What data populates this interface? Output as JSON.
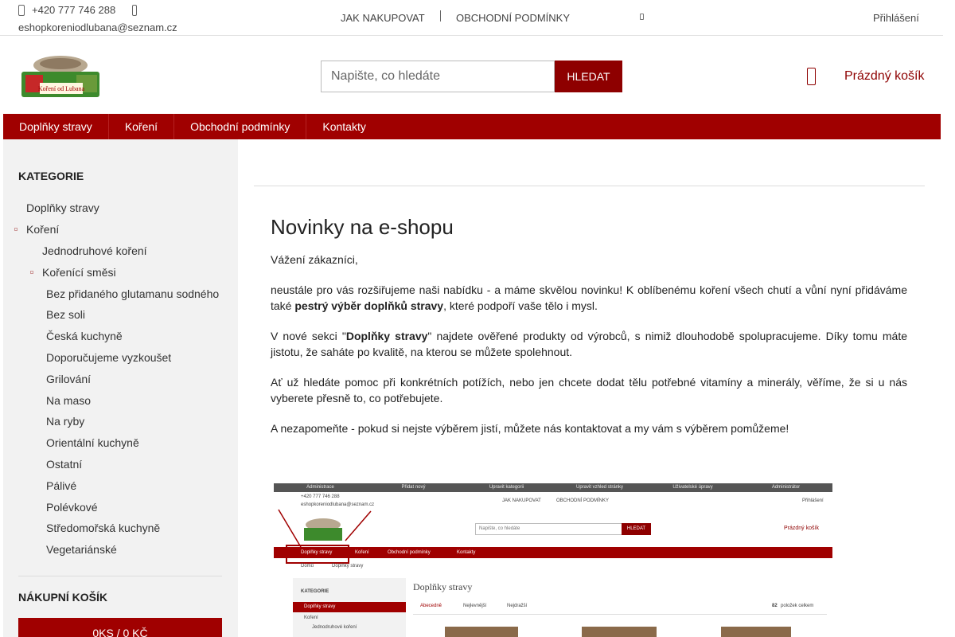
{
  "topbar": {
    "phone": "+420 777 746 288",
    "email": "eshopkoreniodlubana@seznam.cz",
    "links": [
      "JAK NAKUPOVAT",
      "OBCHODNÍ PODMÍNKY"
    ],
    "login": "Přihlášení"
  },
  "header": {
    "logo_text": "Koření od Lubana",
    "search_placeholder": "Napište, co hledáte",
    "search_button": "HLEDAT",
    "cart_label": "Prázdný košík"
  },
  "nav": [
    "Doplňky stravy",
    "Koření",
    "Obchodní podmínky",
    "Kontakty"
  ],
  "sidebar": {
    "categories_title": "KATEGORIE",
    "level1": [
      "Doplňky stravy",
      "Koření"
    ],
    "level2": [
      "Jednodruhové koření",
      "Kořenící směsi"
    ],
    "level3": [
      "Bez přidaného glutamanu sodného",
      "Bez soli",
      "Česká kuchyně",
      "Doporučujeme vyzkoušet",
      "Grilování",
      "Na maso",
      "Na ryby",
      "Orientální kuchyně",
      "Ostatní",
      "Pálivé",
      "Polévkové",
      "Středomořská kuchyně",
      "Vegetariánské"
    ],
    "cart_title": "NÁKUPNÍ KOŠÍK",
    "cart_value": "0KS / 0 KČ"
  },
  "article": {
    "title": "Novinky na e-shopu",
    "greeting": "Vážení zákazníci,",
    "p1_a": "neustále pro vás rozšiřujeme naši nabídku - a máme skvělou novinku! K oblíbenému koření všech chutí a vůní nyní přidáváme také ",
    "p1_bold": "pestrý výběr doplňků stravy",
    "p1_b": ", které podpoří vaše tělo i mysl.",
    "p2_a": "V nové sekci \"",
    "p2_bold": "Doplňky stravy",
    "p2_b": "\" najdete ověřené produkty od výrobců, s nimiž dlouhodobě spolupracujeme. Díky tomu máte jistotu, že saháte po kvalitě, na kterou se můžete spolehnout.",
    "p3": "Ať už hledáte pomoc při konkrétních potížích, nebo jen chcete dodat tělu potřebné vitamíny a minerály, věříme, že si u nás vyberete přesně to, co potřebujete.",
    "p4": "A nezapomeňte - pokud si nejste výběrem jistí, můžete nás kontaktovat a my vám s výběrem pomůžeme!"
  },
  "screenshot": {
    "admin_bar": [
      "Administrace",
      "Přidat nový",
      "Upravit kategorii",
      "Upravit vzhled stránky",
      "Uživatelské úpravy",
      "Administrátor"
    ],
    "phone": "+420 777 746 288",
    "email": "eshopkoreniodlubana@seznam.cz",
    "links": [
      "JAK NAKUPOVAT",
      "OBCHODNÍ PODMÍNKY"
    ],
    "login": "Přihlášení",
    "search_placeholder": "Napište, co hledáte",
    "search_button": "HLEDAT",
    "cart": "Prázdný košík",
    "nav": [
      "Doplňky stravy",
      "Koření",
      "Obchodní podmínky",
      "Kontakty"
    ],
    "breadcrumb": [
      "Domů",
      "Doplňky stravy"
    ],
    "page_title": "Doplňky stravy",
    "side_title": "KATEGORIE",
    "side_items": [
      "Doplňky stravy",
      "Koření",
      "Jednodruhové koření"
    ],
    "sort": [
      "Abecedně",
      "Nejlevnější",
      "Nejdražší"
    ],
    "count_num": "82",
    "count_label": "položek celkem"
  },
  "colors": {
    "brand": "#a00000",
    "brand_dark": "#8e0000",
    "sidebar_bg": "#f2f2f2"
  },
  "icons": [
    "phone-icon",
    "mail-icon",
    "chevron-down-icon",
    "cart-icon"
  ]
}
